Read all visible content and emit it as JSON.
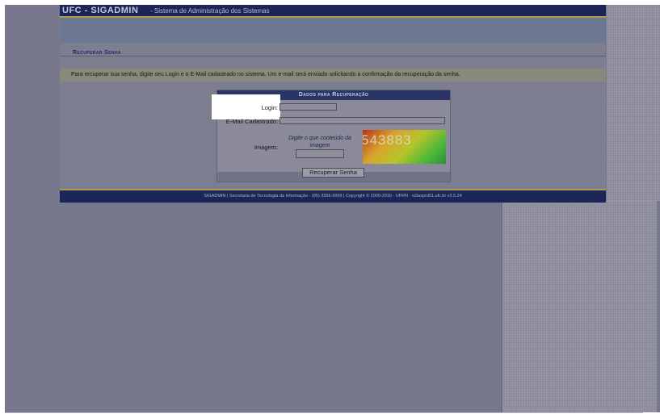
{
  "header": {
    "app_title": "UFC - SIGADMIN",
    "app_subtitle": "- Sistema de Administração dos Sistemas"
  },
  "page": {
    "title": "Recuperar Senha",
    "info": "Para recuperar sua senha, digite seu Login e o E-Mail cadastrado no sistema. Um e-mail será enviado solicitando a confirmação da recuperação da senha."
  },
  "form": {
    "caption": "Dados para Recuperação",
    "login_label": "Login:",
    "login_value": "",
    "email_label": "E-Mail Cadastrado:",
    "email_value": "",
    "image_label": "Imagem:",
    "captcha_hint": "Digite o que conteúdo da imagem",
    "captcha_value": "",
    "captcha_text": "543883",
    "submit_label": "Recuperar Senha"
  },
  "footer": {
    "text": "SIGADMIN | Secretaria de Tecnologia da Informação - (85) 3366-9999 | Copyright © 2009-2016 - UFRN - si3asprd01.ufc.br v2.5.24"
  },
  "colors": {
    "header_bg": "#1b2557",
    "accent_rule": "#ad9c4c",
    "page_bg": "#77778d"
  }
}
